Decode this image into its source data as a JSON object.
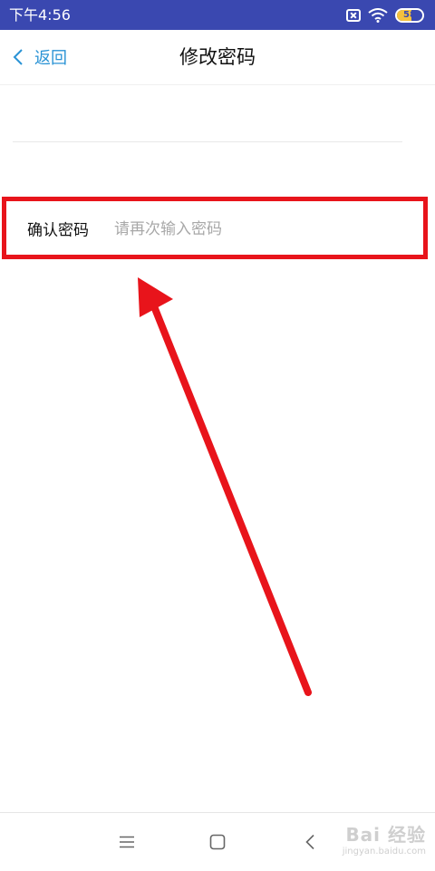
{
  "status_bar": {
    "time": "下午4:56",
    "battery_level": "58",
    "battery_fraction": 0.58,
    "icons": [
      "sim-card-crossed-icon",
      "wifi-icon",
      "battery-icon"
    ],
    "background_color": "#3a48b0"
  },
  "header": {
    "back_label": "返回",
    "title": "修改密码",
    "accent_color": "#2a93d5"
  },
  "form": {
    "confirm_label": "确认密码",
    "confirm_placeholder": "请再次输入密码",
    "confirm_value": ""
  },
  "annotation": {
    "color": "#e8141b"
  },
  "system_nav": {
    "icons": [
      "menu-icon",
      "home-icon",
      "back-icon"
    ]
  },
  "watermark": {
    "logo": "Bai 经验",
    "url": "jingyan.baidu.com"
  }
}
